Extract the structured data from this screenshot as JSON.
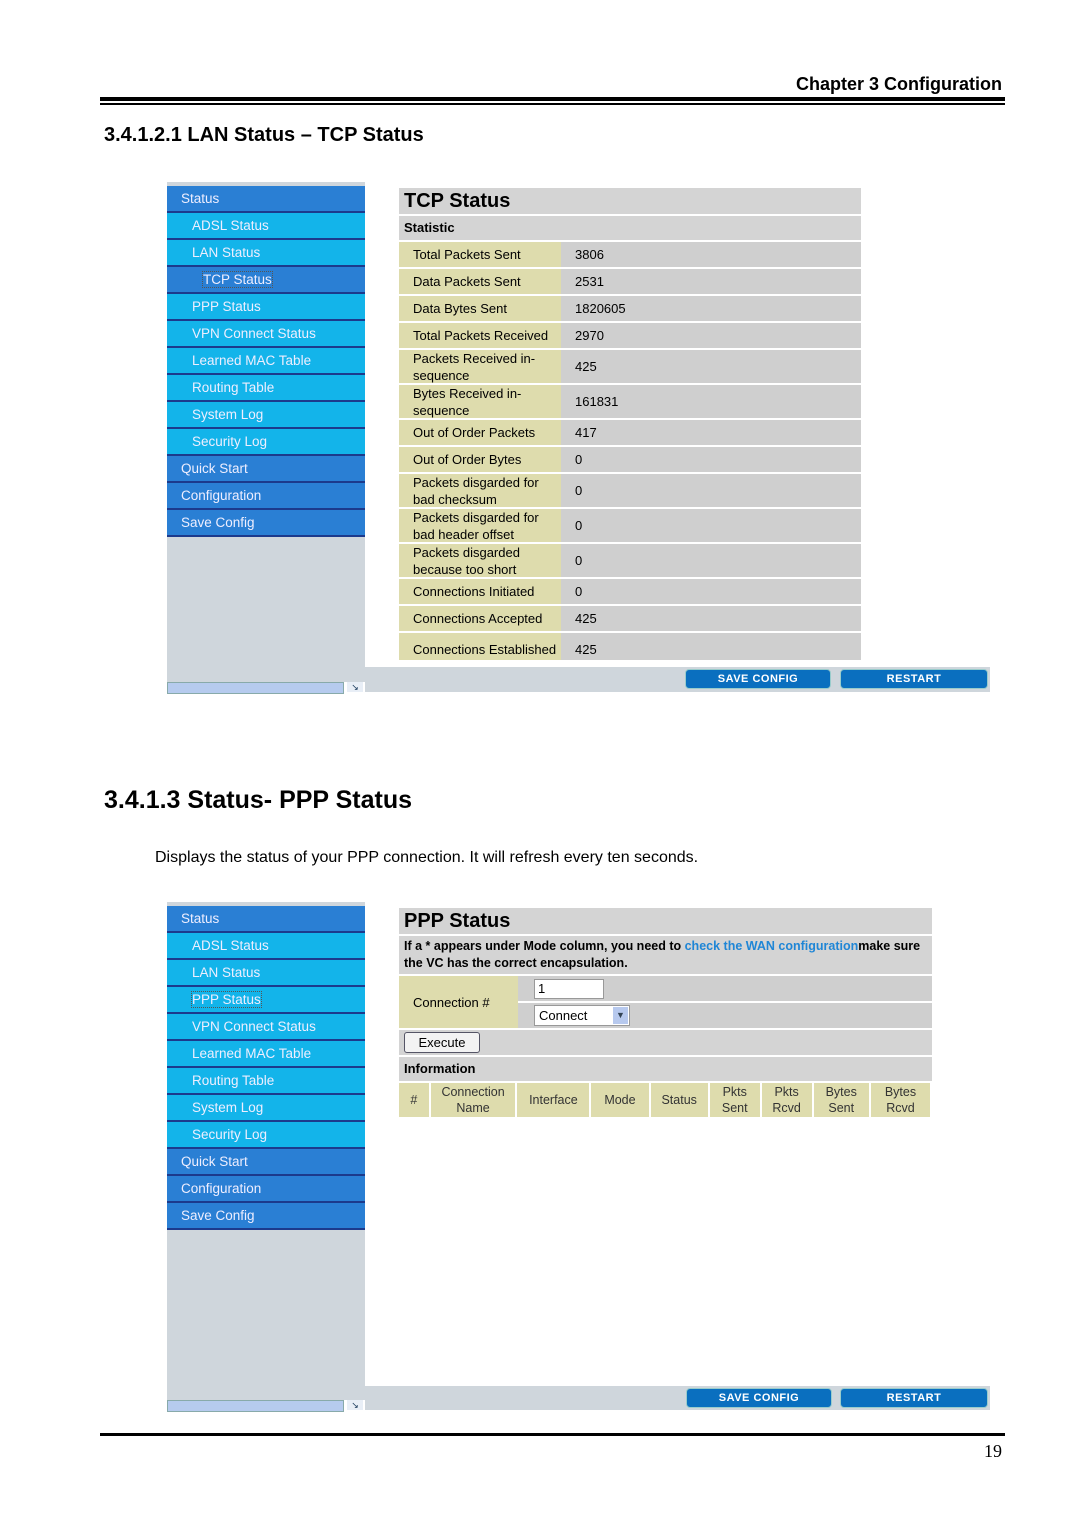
{
  "page": {
    "chapter_header": "Chapter 3 Configuration",
    "section_lan_tcp_heading": "3.4.1.2.1 LAN Status – TCP Status",
    "section_ppp_heading": "3.4.1.3 Status- PPP Status",
    "section_ppp_paragraph": "Displays the status of your PPP connection. It will refresh every ten seconds.",
    "page_number": "19"
  },
  "tcp_screenshot": {
    "sidebar": [
      {
        "label": "Status",
        "level": "main"
      },
      {
        "label": "ADSL Status",
        "level": "sub"
      },
      {
        "label": "LAN Status",
        "level": "sub"
      },
      {
        "label": "TCP Status",
        "level": "sub2",
        "selected": true
      },
      {
        "label": "PPP Status",
        "level": "sub"
      },
      {
        "label": "VPN Connect Status",
        "level": "sub"
      },
      {
        "label": "Learned MAC Table",
        "level": "sub"
      },
      {
        "label": "Routing Table",
        "level": "sub"
      },
      {
        "label": "System Log",
        "level": "sub"
      },
      {
        "label": "Security Log",
        "level": "sub"
      },
      {
        "label": "Quick Start",
        "level": "main"
      },
      {
        "label": "Configuration",
        "level": "main"
      },
      {
        "label": "Save Config",
        "level": "main"
      }
    ],
    "title": "TCP Status",
    "subtitle": "Statistic",
    "rows": [
      {
        "label": "Total Packets Sent",
        "value": "3806"
      },
      {
        "label": "Data Packets Sent",
        "value": "2531"
      },
      {
        "label": "Data Bytes Sent",
        "value": "1820605"
      },
      {
        "label": "Total Packets Received",
        "value": "2970"
      },
      {
        "label": "Packets Received in-sequence",
        "value": "425"
      },
      {
        "label": "Bytes Received in-sequence",
        "value": "161831"
      },
      {
        "label": "Out of Order Packets",
        "value": "417"
      },
      {
        "label": "Out of Order Bytes",
        "value": "0"
      },
      {
        "label": "Packets disgarded for bad checksum",
        "value": "0"
      },
      {
        "label": "Packets disgarded for bad header offset",
        "value": "0"
      },
      {
        "label": "Packets disgarded because too short",
        "value": "0"
      },
      {
        "label": "Connections Initiated",
        "value": "0"
      },
      {
        "label": "Connections Accepted",
        "value": "425"
      },
      {
        "label": "Connections Established",
        "value": "425"
      }
    ],
    "buttons": {
      "save_config": "SAVE CONFIG",
      "restart": "RESTART"
    }
  },
  "ppp_screenshot": {
    "sidebar": [
      {
        "label": "Status",
        "level": "main"
      },
      {
        "label": "ADSL Status",
        "level": "sub"
      },
      {
        "label": "LAN Status",
        "level": "sub"
      },
      {
        "label": "PPP Status",
        "level": "sub",
        "selected": true
      },
      {
        "label": "VPN Connect Status",
        "level": "sub"
      },
      {
        "label": "Learned MAC Table",
        "level": "sub"
      },
      {
        "label": "Routing Table",
        "level": "sub"
      },
      {
        "label": "System Log",
        "level": "sub"
      },
      {
        "label": "Security Log",
        "level": "sub"
      },
      {
        "label": "Quick Start",
        "level": "main"
      },
      {
        "label": "Configuration",
        "level": "main"
      },
      {
        "label": "Save Config",
        "level": "main"
      }
    ],
    "title": "PPP Status",
    "notice_prefix": "If a * appears under Mode column, you need to ",
    "notice_link": "check the WAN configuration",
    "notice_suffix": "make sure the VC has the correct encapsulation.",
    "connection_label": "Connection #",
    "connection_value": "1",
    "action_selected": "Connect",
    "execute_label": "Execute",
    "information_label": "Information",
    "columns": [
      "#",
      "Connection Name",
      "Interface",
      "Mode",
      "Status",
      "Pkts Sent",
      "Pkts Rcvd",
      "Bytes Sent",
      "Bytes Rcvd"
    ],
    "buttons": {
      "save_config": "SAVE CONFIG",
      "restart": "RESTART"
    },
    "colors": {
      "link": "#1f86d6",
      "nav_main": "#2a7fd4",
      "nav_sub": "#13b4ea",
      "label_cell": "#dedcad",
      "value_cell": "#cfcfcf",
      "button": "#0a6fbf"
    }
  }
}
